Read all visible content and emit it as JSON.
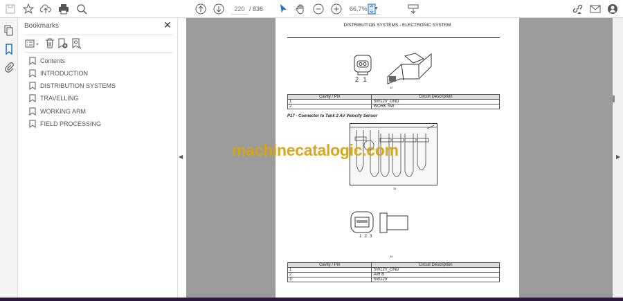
{
  "toolbar": {
    "page_current": "220",
    "page_total": "/ 836",
    "zoom": "66,7%"
  },
  "bookmarks": {
    "title": "Bookmarks",
    "close": "✕",
    "items": [
      {
        "label": "Contents"
      },
      {
        "label": "INTRODUCTION"
      },
      {
        "label": "DISTRIBUTION SYSTEMS"
      },
      {
        "label": "TRAVELLING"
      },
      {
        "label": "WORKING ARM"
      },
      {
        "label": "FIELD PROCESSING"
      }
    ]
  },
  "page": {
    "header": "DISTRIBUTION SYSTEMS - ELECTRONIC SYSTEM",
    "fig1_pins": "2 1",
    "fig1_caption": "32",
    "table_headers": [
      "Cavity / Pin",
      "Circuit Description"
    ],
    "table1": [
      [
        "1",
        "SW12V_GND"
      ],
      [
        "2",
        "WORK SW"
      ]
    ],
    "section_title": "P17 - Connector to Tank 2 Air Velocity Sensor",
    "fig2_caption": "33",
    "fig3_pins": "1 2 3",
    "fig3_caption": "34",
    "table2": [
      [
        "1",
        "SW12V_GND"
      ],
      [
        "2",
        "AIR B"
      ],
      [
        "3",
        "SW12V"
      ]
    ]
  },
  "watermark": "machinecatalogic.com",
  "colors": {
    "accent": "#1a6dcc",
    "watermark": "#d9a514",
    "viewer_bg": "#9b9b9b"
  }
}
